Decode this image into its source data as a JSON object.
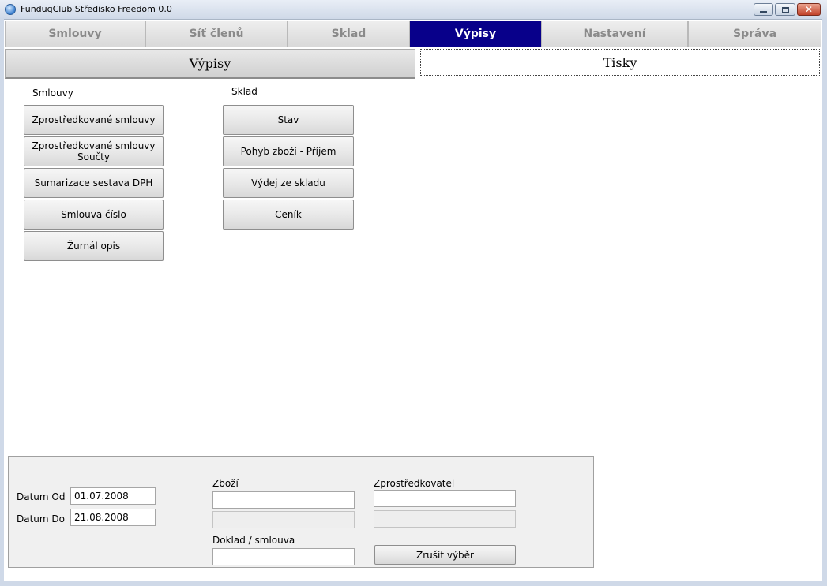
{
  "window": {
    "title": "FunduqClub Středisko Freedom 0.0"
  },
  "main_tabs": [
    {
      "label": "Smlouvy"
    },
    {
      "label": "Síť členů"
    },
    {
      "label": "Sklad"
    },
    {
      "label": "Výpisy",
      "active": true
    },
    {
      "label": "Nastavení"
    },
    {
      "label": "Správa"
    }
  ],
  "sub_tabs": [
    {
      "label": "Výpisy",
      "active": true
    },
    {
      "label": "Tisky"
    }
  ],
  "smlouvy": {
    "heading": "Smlouvy",
    "buttons": [
      "Zprostředkované smlouvy",
      "Zprostředkované smlouvy\nSoučty",
      "Sumarizace sestava DPH",
      "Smlouva číslo",
      "Žurnál opis"
    ]
  },
  "sklad": {
    "heading": "Sklad",
    "buttons": [
      "Stav",
      "Pohyb zboží - Příjem",
      "Výdej ze skladu",
      "Ceník"
    ]
  },
  "filter": {
    "datum_od_label": "Datum Od",
    "datum_od_value": "01.07.2008",
    "datum_do_label": "Datum Do",
    "datum_do_value": "21.08.2008",
    "zbozi_label": "Zboží",
    "zbozi_value": "",
    "zbozi_detail": "",
    "zprostredkovatel_label": "Zprostředkovatel",
    "zprostredkovatel_value": "",
    "zprostredkovatel_detail": "",
    "doklad_label": "Doklad / smlouva",
    "doklad_value": "",
    "clear_button": "Zrušit výběr"
  },
  "colors": {
    "active_tab": "#08008a",
    "inactive_tab_text": "#8a8a8a"
  }
}
